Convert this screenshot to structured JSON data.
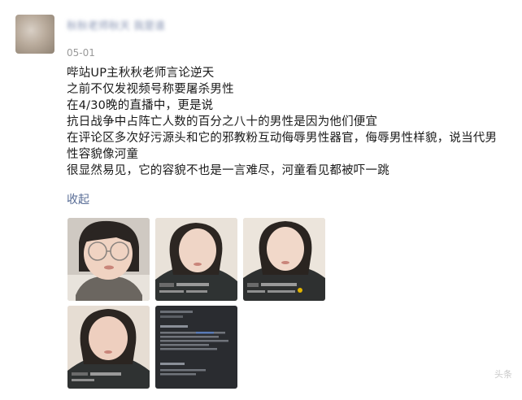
{
  "post": {
    "username": "秋秋老师秋天 我是谁",
    "date": "05-01",
    "lines": [
      "哔站UP主秋秋老师言论逆天",
      "之前不仅发视频号称要屠杀男性",
      "在4/30晚的直播中，更是说",
      "抗日战争中占阵亡人数的百分之八十的男性是因为他们便宜",
      "在评论区多次好污源头和它的邪教粉互动侮辱男性器官，侮辱男性样貌，说当代男",
      "性容貌像河童",
      "很显然易见，它的容貌不也是一言难尽，河童看见都被吓一跳"
    ],
    "collapse_label": "收起"
  },
  "images": [
    {
      "icon": "photo-glasses-closeup"
    },
    {
      "icon": "photo-livestream-screenshot"
    },
    {
      "icon": "photo-livestream-screenshot"
    },
    {
      "icon": "photo-livestream-screenshot"
    },
    {
      "icon": "photo-comment-screenshot"
    }
  ],
  "watermark": "头条"
}
